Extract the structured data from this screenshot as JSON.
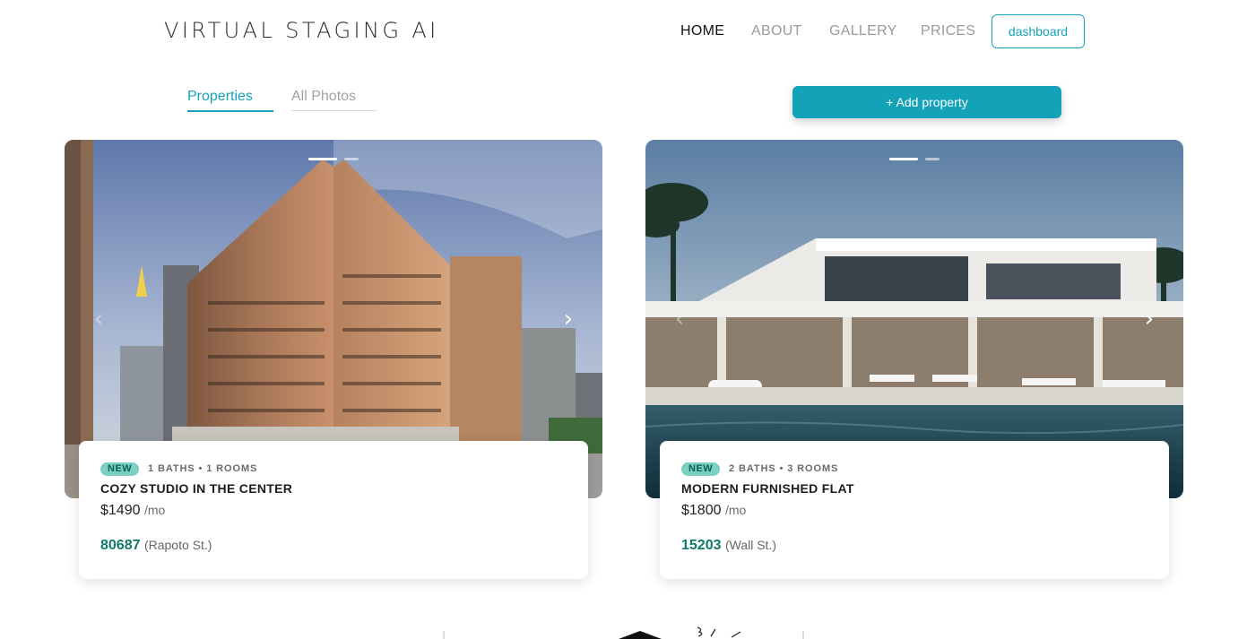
{
  "brand": "VIRTUAL STAGING AI",
  "nav": [
    "HOME",
    "ABOUT",
    "GALLERY",
    "PRICES"
  ],
  "nav_active": "HOME",
  "dashboard_label": "dashboard",
  "tabs": [
    "Properties",
    "All Photos"
  ],
  "add_property_label": "+ Add property",
  "colors": {
    "accent": "#13a2b8",
    "badge": "#7ccfc3",
    "zip": "#0f7a69"
  },
  "properties": [
    {
      "badge": "NEW",
      "meta": "1 BATHS • 1 ROOMS",
      "title": "COZY STUDIO IN THE CENTER",
      "price": "$1490",
      "per": "/mo",
      "zip": "80687",
      "street": "(Rapoto St.)",
      "image": "historic brick office building"
    },
    {
      "badge": "NEW",
      "meta": "2 BATHS • 3 ROOMS",
      "title": "MODERN FURNISHED FLAT",
      "price": "$1800",
      "per": "/mo",
      "zip": "15203",
      "street": "(Wall St.)",
      "image": "modern white villa with pool"
    }
  ],
  "icons": {
    "prev": "chevron-left-icon",
    "next": "chevron-right-icon"
  }
}
